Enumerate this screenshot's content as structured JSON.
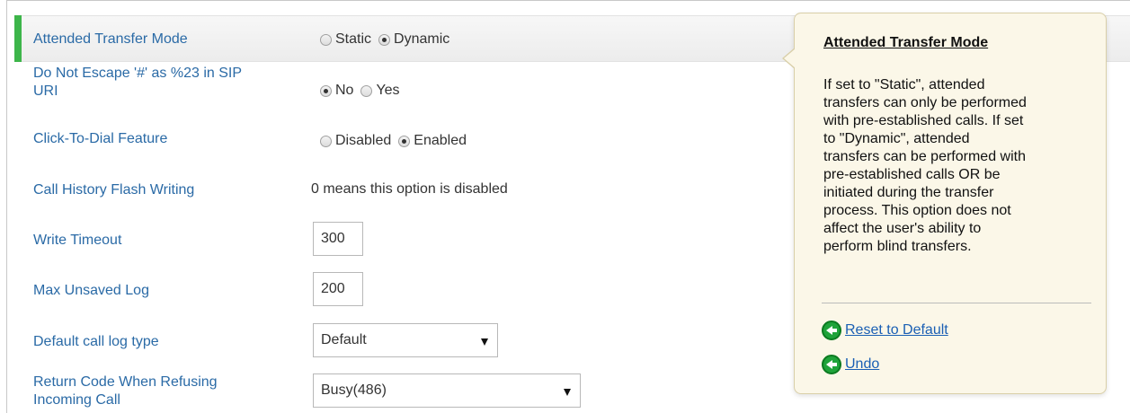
{
  "rows": {
    "attended_transfer": {
      "label": "Attended Transfer Mode",
      "options": [
        "Static",
        "Dynamic"
      ],
      "selected": "Dynamic"
    },
    "do_not_escape": {
      "label_line1": "Do Not Escape '#' as %23 in SIP",
      "label_line2": "URI",
      "options": [
        "No",
        "Yes"
      ],
      "selected": "No"
    },
    "click_to_dial": {
      "label": "Click-To-Dial Feature",
      "options": [
        "Disabled",
        "Enabled"
      ],
      "selected": "Enabled"
    },
    "call_history_flash": {
      "label": "Call History Flash Writing",
      "note": "0 means this option is disabled"
    },
    "write_timeout": {
      "label": "Write Timeout",
      "value": "300"
    },
    "max_unsaved_log": {
      "label": "Max Unsaved Log",
      "value": "200"
    },
    "default_call_log_type": {
      "label": "Default call log type",
      "value": "Default"
    },
    "return_code": {
      "label_line1": "Return Code When Refusing",
      "label_line2": "Incoming Call",
      "value": "Busy(486)"
    }
  },
  "tooltip": {
    "title": "Attended Transfer Mode",
    "body_lines": [
      "If set to \"Static\", attended",
      "transfers can only be performed",
      "with pre-established calls. If set",
      "to \"Dynamic\", attended",
      "transfers can be performed with",
      "pre-established calls OR be",
      "initiated during the transfer",
      "process. This option does not",
      "affect the user's ability to",
      "perform blind transfers."
    ],
    "reset_label": "Reset to Default",
    "undo_label": "Undo"
  },
  "colors": {
    "active_marker": "#3db54a",
    "label_blue": "#2a6aa6",
    "tooltip_bg": "#fbf7e8",
    "link_blue": "#1a5fb4",
    "icon_green": "#1fa33a"
  }
}
